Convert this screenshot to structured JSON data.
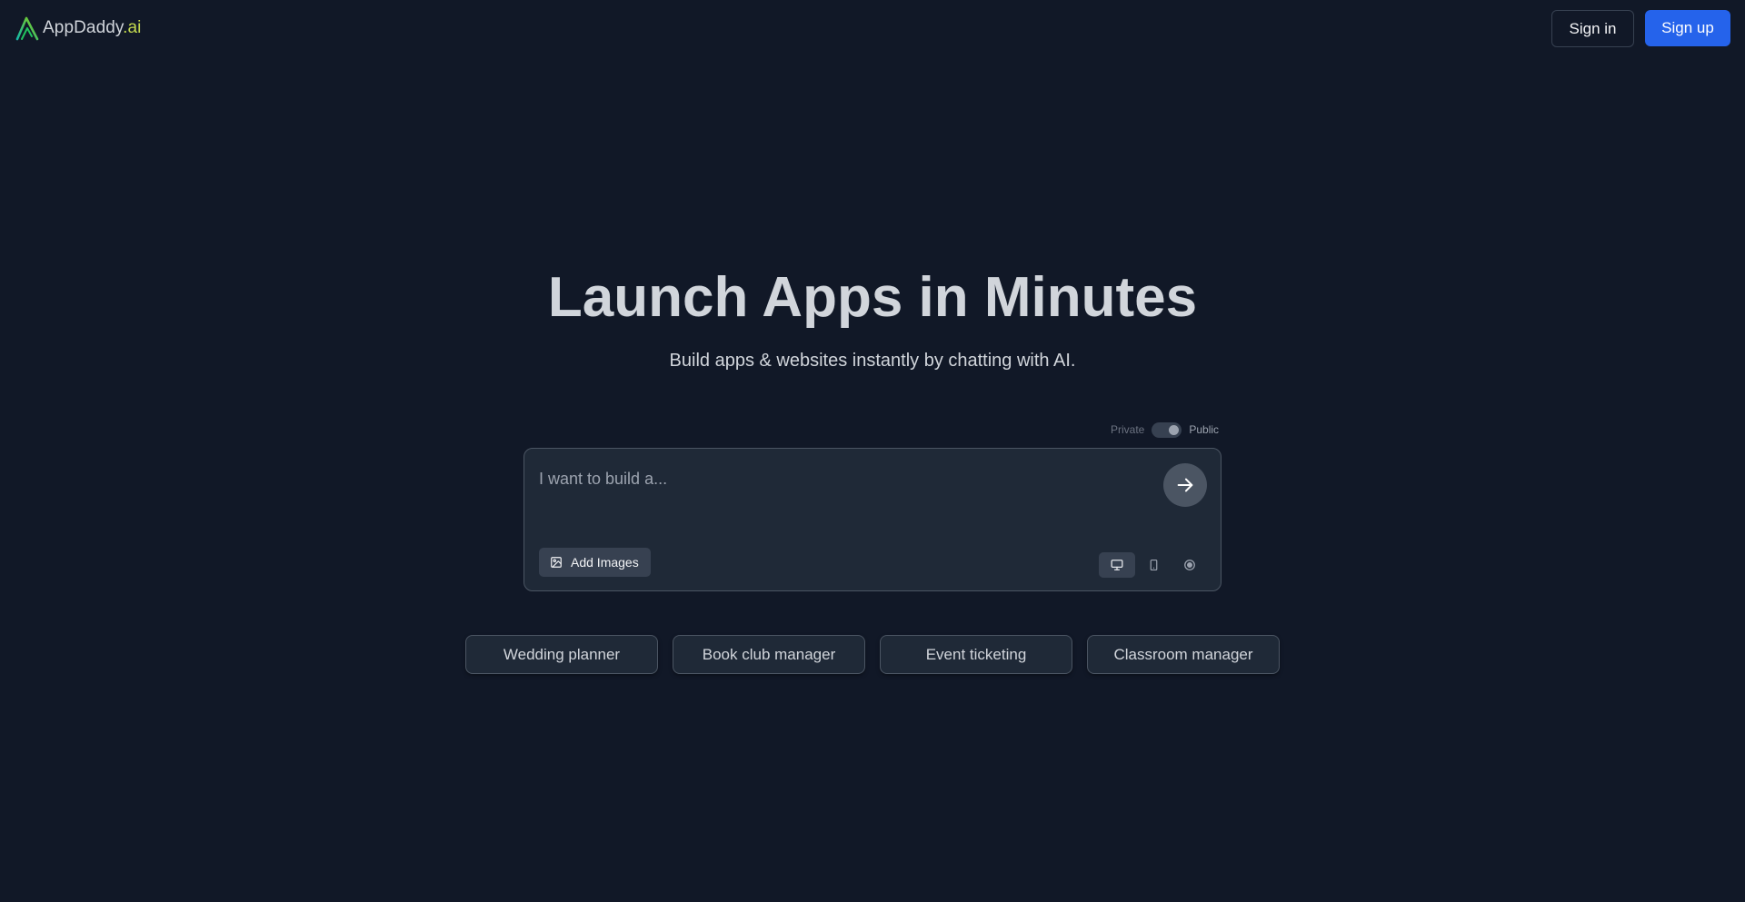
{
  "header": {
    "logo_name": "AppDaddy",
    "logo_tld": ".ai",
    "signin_label": "Sign in",
    "signup_label": "Sign up"
  },
  "hero": {
    "title": "Launch Apps in Minutes",
    "subtitle": "Build apps & websites instantly by chatting with AI."
  },
  "visibility": {
    "private_label": "Private",
    "public_label": "Public",
    "selected": "Public"
  },
  "prompt": {
    "placeholder": "I want to build a...",
    "value": "",
    "add_images_label": "Add Images",
    "device_modes": [
      "desktop-icon",
      "mobile-icon",
      "record-icon"
    ],
    "active_device": "desktop"
  },
  "suggestions": [
    {
      "label": "Wedding planner"
    },
    {
      "label": "Book club manager"
    },
    {
      "label": "Event ticketing"
    },
    {
      "label": "Classroom manager"
    }
  ],
  "colors": {
    "background": "#111827",
    "accent": "#2563eb",
    "logo_tld": "#c3d94e"
  }
}
